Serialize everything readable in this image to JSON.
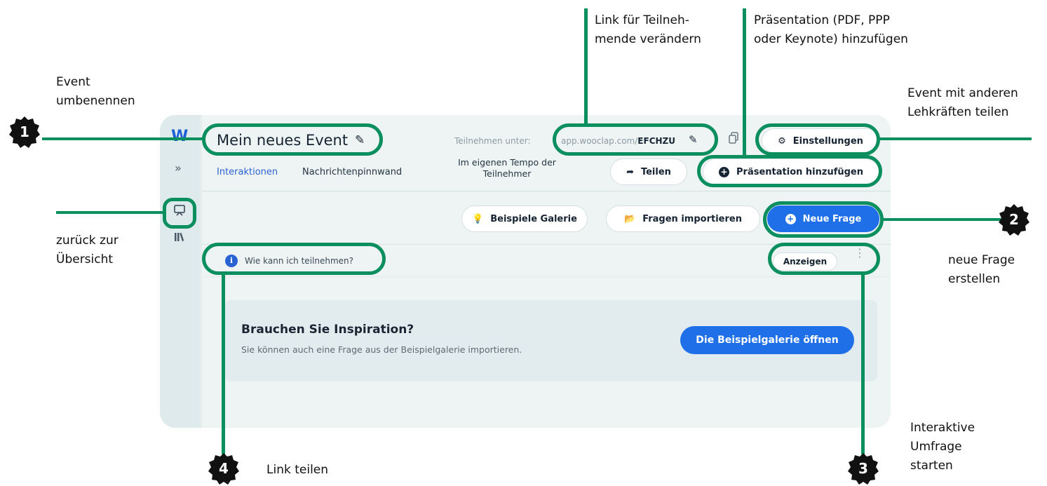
{
  "annotations": {
    "rename_event": "Event\numbenennen",
    "change_link": "Link für Teilneh-\nmende verändern",
    "add_presentation": "Präsentation (PDF, PPP\noder Keynote) hinzufügen",
    "share_event": "Event mit anderen\nLehkräften teilen",
    "back_overview": "zurück zur\nÜbersicht",
    "new_question": "neue Frage\nerstellen",
    "start_poll": "Interaktive\nUmfrage\nstarten",
    "share_link": "Link teilen"
  },
  "badges": {
    "b1": "1",
    "b2": "2",
    "b3": "3",
    "b4": "4"
  },
  "app": {
    "logo": "W",
    "event_title": "Mein neues Event",
    "join_label": "Teilnehmen unter:",
    "join_url_prefix": "app.wooclap.com/",
    "join_code": "EFCHZU",
    "settings_label": "Einstellungen",
    "tabs": {
      "interactions": "Interaktionen",
      "message_wall": "Nachrichtenpinnwand",
      "self_paced": "Im eigenen Tempo der\nTeilnehmer"
    },
    "share_label": "Teilen",
    "add_presentation_label": "Präsentation hinzufügen",
    "examples_gallery_label": "Beispiele Galerie",
    "import_questions_label": "Fragen importieren",
    "new_question_label": "Neue Frage",
    "how_to_join_label": "Wie kann ich teilnehmen?",
    "show_label": "Anzeigen",
    "inspiration_title": "Brauchen Sie Inspiration?",
    "inspiration_text": "Sie können auch eine Frage aus der Beispielgalerie importieren.",
    "open_gallery_label": "Die Beispielgalerie öffnen"
  },
  "colors": {
    "accent_green": "#0c8f5f",
    "brand_blue": "#1e6fe8"
  }
}
